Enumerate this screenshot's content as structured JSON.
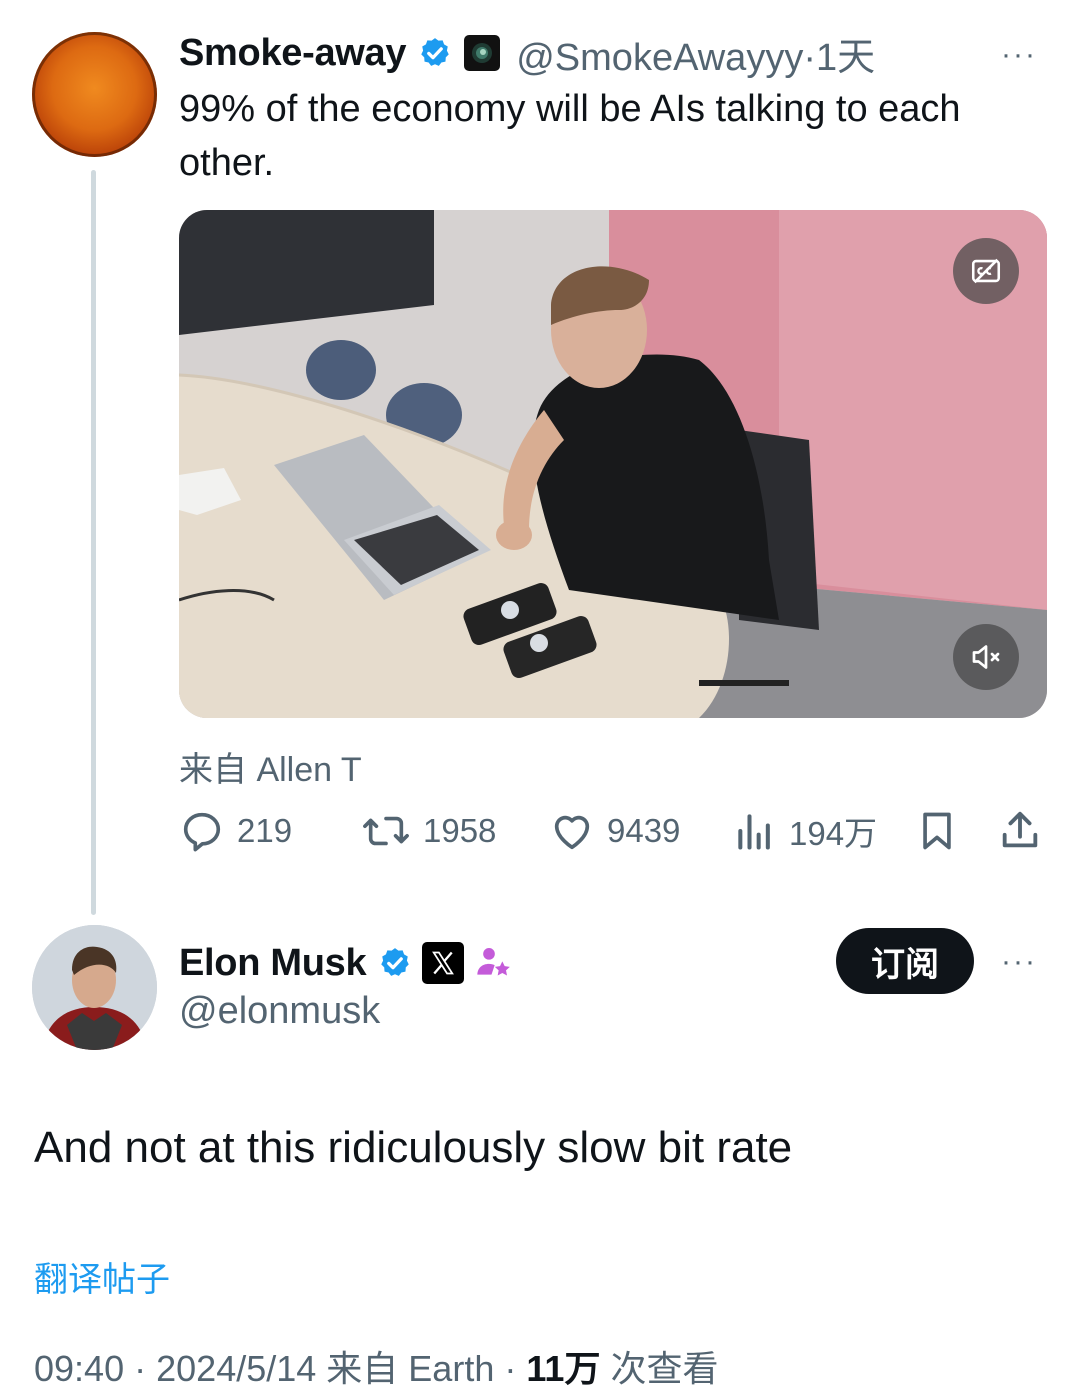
{
  "quoted": {
    "author_name": "Smoke-away",
    "handle": "@SmokeAwayyy",
    "separator": "·",
    "time": "1天",
    "more": "···",
    "text": "99% of the economy will be AIs talking to each other.",
    "media_source": "来自 Allen T",
    "actions": {
      "replies": "219",
      "reposts": "1958",
      "likes": "9439",
      "views": "194万"
    }
  },
  "tweet": {
    "author_name": "Elon Musk",
    "handle": "@elonmusk",
    "subscribe_label": "订阅",
    "more": "···",
    "text": "And not at this ridiculously slow bit rate",
    "translate_label": "翻译帖子",
    "meta": {
      "time": "09:40",
      "sep1": "·",
      "date": "2024/5/14",
      "source": "来自 Earth",
      "sep2": "·",
      "views_count": "11万",
      "views_label": "次查看"
    }
  },
  "colors": {
    "verified_blue": "#1d9bf0",
    "text_secondary": "#536471",
    "affiliate_purple": "#c45bd9"
  },
  "icons": [
    "verified-badge-icon",
    "profile-square-icon",
    "more-icon",
    "captions-off-icon",
    "mute-icon",
    "reply-icon",
    "repost-icon",
    "like-icon",
    "views-icon",
    "bookmark-icon",
    "share-icon",
    "x-logo-icon",
    "affiliate-icon"
  ]
}
